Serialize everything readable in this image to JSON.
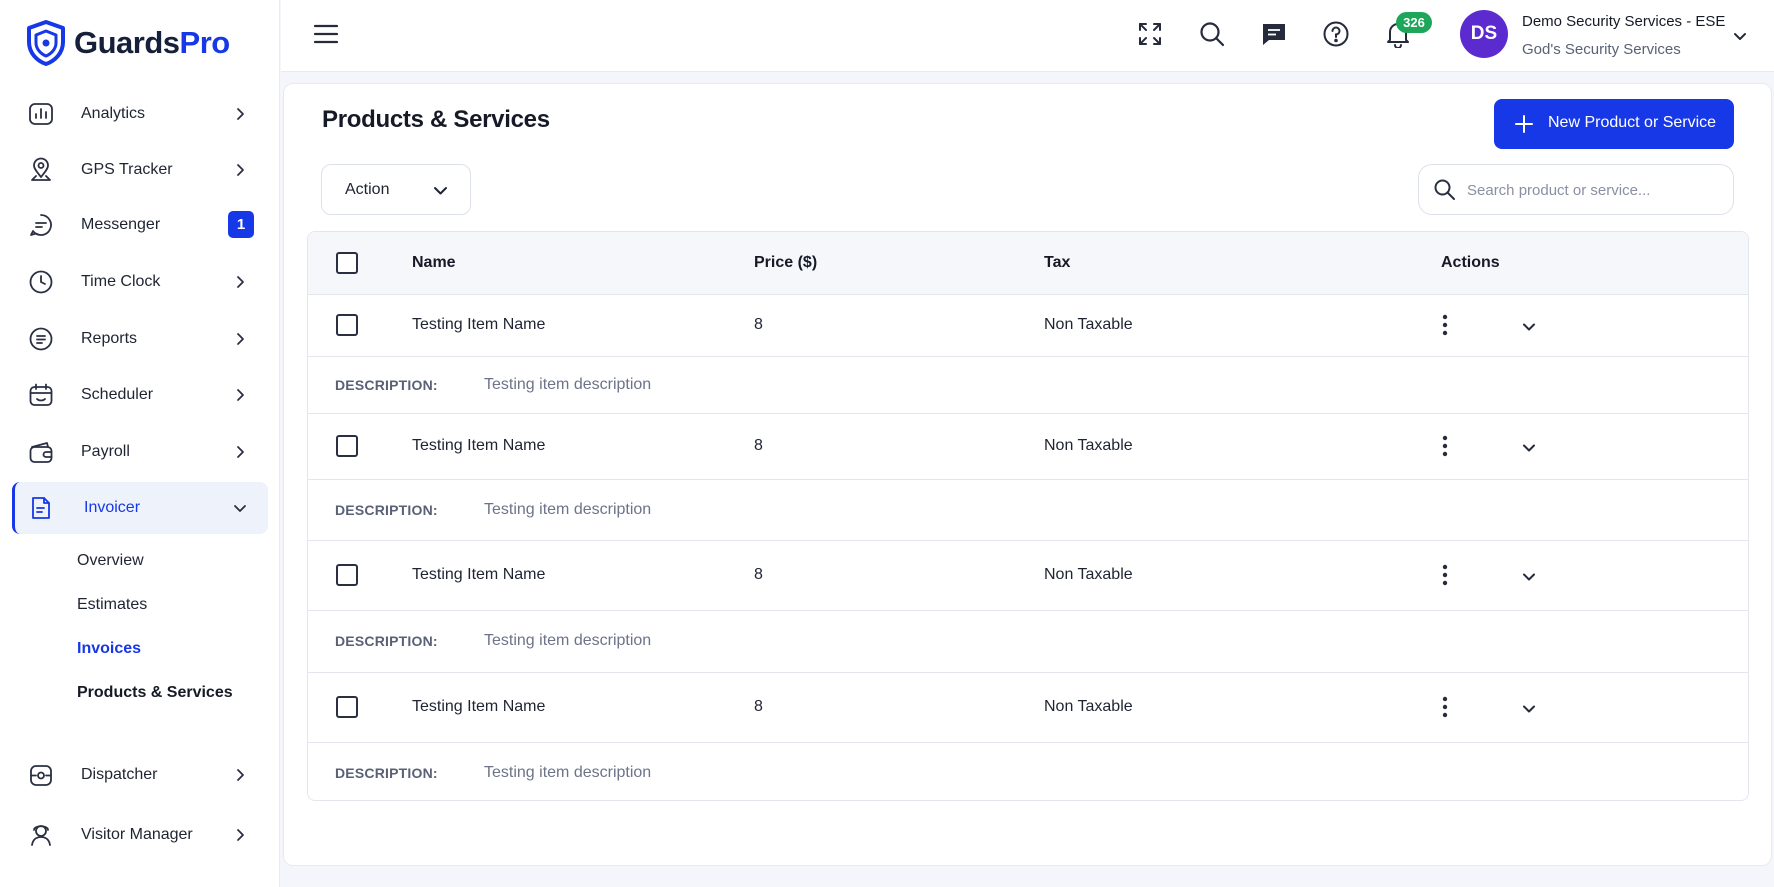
{
  "brand": {
    "name_part1": "Guards",
    "name_part2": "Pro",
    "accent": "#1638e6"
  },
  "sidebar": {
    "items": [
      {
        "label": "Analytics",
        "icon": "analytics-icon"
      },
      {
        "label": "GPS Tracker",
        "icon": "map-pin-icon"
      },
      {
        "label": "Messenger",
        "icon": "chat-bubble-icon",
        "badge": "1"
      },
      {
        "label": "Time Clock",
        "icon": "clock-icon"
      },
      {
        "label": "Reports",
        "icon": "reports-icon"
      },
      {
        "label": "Scheduler",
        "icon": "calendar-icon"
      },
      {
        "label": "Payroll",
        "icon": "wallet-icon"
      },
      {
        "label": "Invoicer",
        "icon": "invoice-icon",
        "expanded": true
      },
      {
        "label": "Dispatcher",
        "icon": "dispatcher-icon"
      },
      {
        "label": "Visitor Manager",
        "icon": "visitor-icon"
      }
    ],
    "invoicer_sub": [
      "Overview",
      "Estimates",
      "Invoices",
      "Products & Services"
    ]
  },
  "topbar": {
    "notifications_count": "326",
    "avatar_initials": "DS",
    "user_name": "Demo Security Services - ESE",
    "user_company": "God's Security Services"
  },
  "main": {
    "title": "Products & Services",
    "new_button_label": "New Product or Service",
    "action_label": "Action",
    "search_placeholder": "Search product or service..."
  },
  "table": {
    "headers": {
      "name": "Name",
      "price": "Price ($)",
      "tax": "Tax",
      "actions": "Actions"
    },
    "description_label": "DESCRIPTION:",
    "rows": [
      {
        "name": "Testing Item Name",
        "price": "8",
        "tax": "Non Taxable",
        "description": "Testing item description"
      },
      {
        "name": "Testing Item Name",
        "price": "8",
        "tax": "Non Taxable",
        "description": "Testing item description"
      },
      {
        "name": "Testing Item Name",
        "price": "8",
        "tax": "Non Taxable",
        "description": "Testing item description"
      },
      {
        "name": "Testing Item Name",
        "price": "8",
        "tax": "Non Taxable",
        "description": "Testing item description"
      }
    ]
  }
}
